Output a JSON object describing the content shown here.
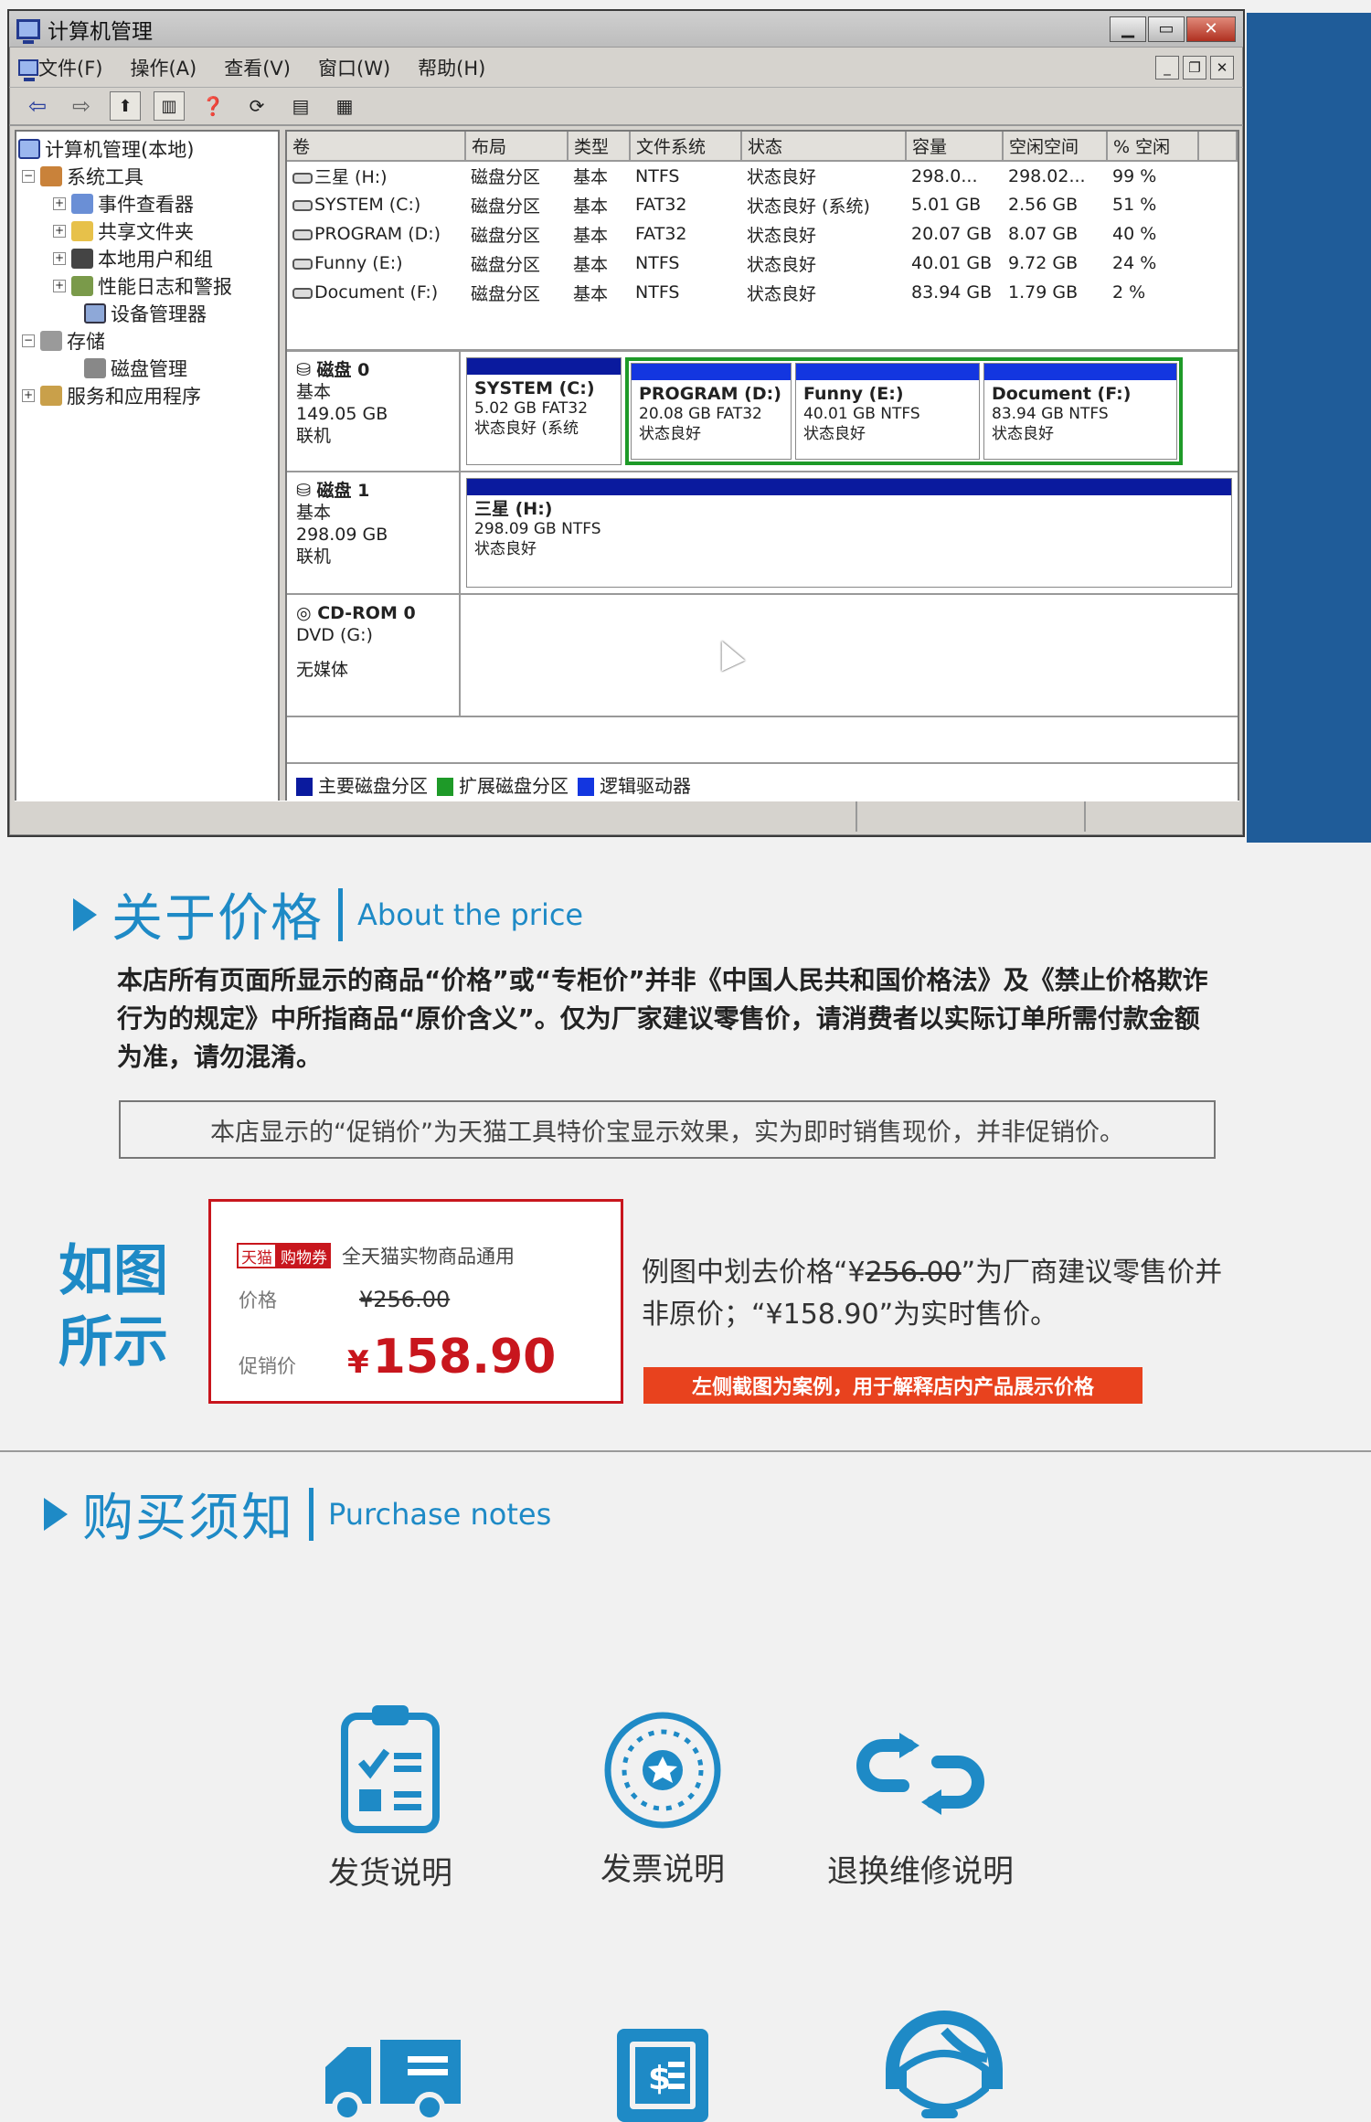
{
  "window": {
    "title": "计算机管理",
    "menu": [
      "文件(F)",
      "操作(A)",
      "查看(V)",
      "窗口(W)",
      "帮助(H)"
    ]
  },
  "tree": {
    "items": [
      {
        "label": "计算机管理(本地)",
        "level": 0,
        "expander": ""
      },
      {
        "label": "系统工具",
        "level": 1,
        "expander": "−"
      },
      {
        "label": "事件查看器",
        "level": 2,
        "expander": "+"
      },
      {
        "label": "共享文件夹",
        "level": 2,
        "expander": "+"
      },
      {
        "label": "本地用户和组",
        "level": 2,
        "expander": "+"
      },
      {
        "label": "性能日志和警报",
        "level": 2,
        "expander": "+"
      },
      {
        "label": "设备管理器",
        "level": 2,
        "expander": ""
      },
      {
        "label": "存储",
        "level": 1,
        "expander": "−"
      },
      {
        "label": "磁盘管理",
        "level": 2,
        "expander": ""
      },
      {
        "label": "服务和应用程序",
        "level": 1,
        "expander": "+"
      }
    ]
  },
  "volume_table": {
    "headers": [
      "卷",
      "布局",
      "类型",
      "文件系统",
      "状态",
      "容量",
      "空闲空间",
      "% 空闲"
    ],
    "rows": [
      [
        "三星 (H:)",
        "磁盘分区",
        "基本",
        "NTFS",
        "状态良好",
        "298.0...",
        "298.02...",
        "99 %"
      ],
      [
        "SYSTEM (C:)",
        "磁盘分区",
        "基本",
        "FAT32",
        "状态良好 (系统)",
        "5.01 GB",
        "2.56 GB",
        "51 %"
      ],
      [
        "PROGRAM (D:)",
        "磁盘分区",
        "基本",
        "FAT32",
        "状态良好",
        "20.07 GB",
        "8.07 GB",
        "40 %"
      ],
      [
        "Funny (E:)",
        "磁盘分区",
        "基本",
        "NTFS",
        "状态良好",
        "40.01 GB",
        "9.72 GB",
        "24 %"
      ],
      [
        "Document (F:)",
        "磁盘分区",
        "基本",
        "NTFS",
        "状态良好",
        "83.94 GB",
        "1.79 GB",
        "2 %"
      ]
    ]
  },
  "disks": {
    "disk0": {
      "name": "磁盘 0",
      "type": "基本",
      "size": "149.05 GB",
      "state": "联机",
      "system": {
        "name": "SYSTEM (C:)",
        "info": "5.02 GB FAT32",
        "status": "状态良好 (系统"
      },
      "logical": [
        {
          "name": "PROGRAM (D:)",
          "info": "20.08 GB FAT32",
          "status": "状态良好"
        },
        {
          "name": "Funny (E:)",
          "info": "40.01 GB NTFS",
          "status": "状态良好"
        },
        {
          "name": "Document (F:)",
          "info": "83.94 GB NTFS",
          "status": "状态良好"
        }
      ]
    },
    "disk1": {
      "name": "磁盘 1",
      "type": "基本",
      "size": "298.09 GB",
      "state": "联机",
      "part": {
        "name": "三星 (H:)",
        "info": "298.09 GB NTFS",
        "status": "状态良好"
      }
    },
    "cdrom": {
      "name": "CD-ROM 0",
      "drive": "DVD (G:)",
      "media": "无媒体"
    }
  },
  "legend": {
    "primary": "主要磁盘分区",
    "extended": "扩展磁盘分区",
    "logical": "逻辑驱动器",
    "colors": {
      "primary": "#0a1a9e",
      "extended": "#1e9a28",
      "logical": "#1336e0"
    }
  },
  "price_section": {
    "title_cn": "关于价格",
    "title_en": "About the price",
    "paragraph": "本店所有页面所显示的商品“价格”或“专柜价”并非《中国人民共和国价格法》及《禁止价格欺诈行为的规定》中所指商品“原价含义”。仅为厂家建议零售价，请消费者以实际订单所需付款金额为准，请勿混淆。",
    "note": "本店显示的“促销价”为天猫工具特价宝显示效果，实为即时销售现价，并非促销价。",
    "example_label": "如图所示",
    "card": {
      "tag_tmall": "天猫",
      "tag_coupon": "购物券",
      "coupon_text": "全天猫实物商品通用",
      "price_label": "价格",
      "price_value": "¥256.00",
      "promo_label": "促销价",
      "promo_symbol": "¥",
      "promo_value": "158.90"
    },
    "explain_1": "例图中划去价格“¥",
    "explain_strike": "256.00",
    "explain_2": "”为厂商建议零售价并非原价；“¥158.90”为实时售价。",
    "banner": "左侧截图为案例，用于解释店内产品展示价格"
  },
  "purchase_section": {
    "title_cn": "购买须知",
    "title_en": "Purchase notes",
    "icons": [
      {
        "label": "发货说明",
        "icon": "clipboard-checklist-icon"
      },
      {
        "label": "发票说明",
        "icon": "star-seal-icon"
      },
      {
        "label": "退换维修说明",
        "icon": "exchange-arrows-icon"
      },
      {
        "label": "",
        "icon": "delivery-truck-icon"
      },
      {
        "label": "",
        "icon": "stamp-dollar-icon"
      },
      {
        "label": "",
        "icon": "customer-service-headset-icon"
      }
    ],
    "accent_color": "#1e8ac6"
  }
}
